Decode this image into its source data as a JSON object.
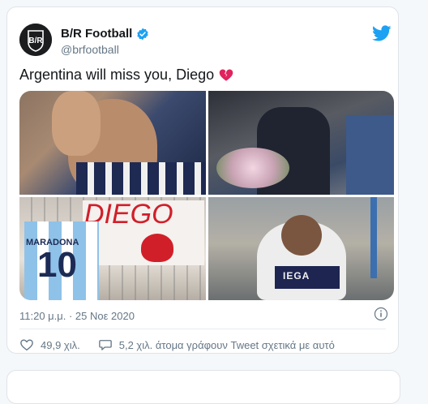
{
  "tweet": {
    "author_name": "B/R Football",
    "author_handle": "@brfootball",
    "avatar_text": "B/R",
    "text": "Argentina will miss you, Diego",
    "timestamp": "11:20 μ.μ. · 25 Νοε 2020",
    "likes": "49,9 χιλ.",
    "conversation": "5,2 χιλ. άτομα γράφουν Tweet σχετικά με αυτό"
  },
  "media": {
    "photo3_banner_text": "DIEGO",
    "photo3_shirt_name": "MARADONA",
    "photo3_shirt_number": "10",
    "photo4_shirt_text": "IEGA"
  },
  "icons": {
    "verified": "verified-badge-icon",
    "twitter": "twitter-bird-icon",
    "emoji": "broken-heart-icon",
    "info": "info-icon",
    "like": "heart-outline-icon",
    "reply": "speech-bubble-icon"
  },
  "colors": {
    "twitter_blue": "#1da1f2",
    "text_primary": "#14171a",
    "text_secondary": "#657786",
    "broken_heart": "#e0245e"
  }
}
